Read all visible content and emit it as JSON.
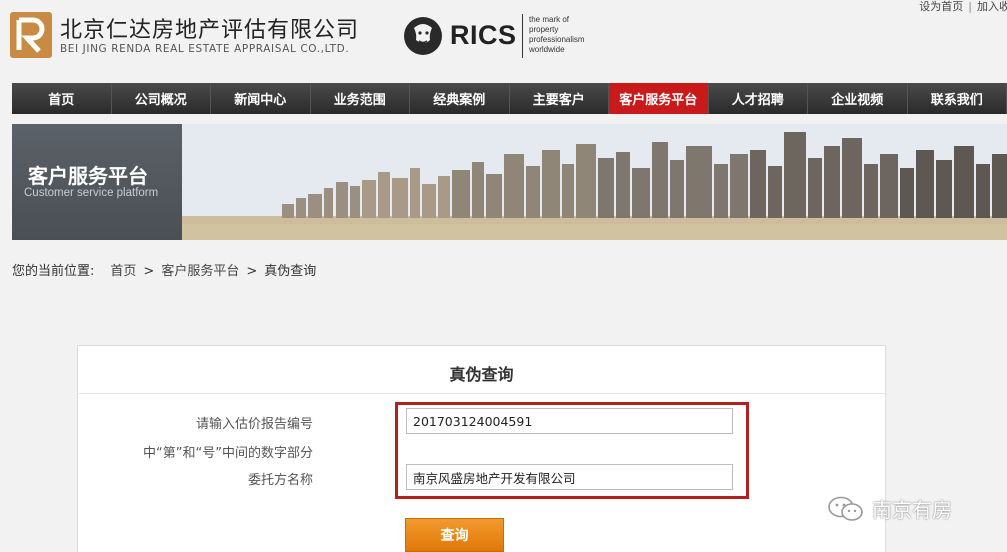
{
  "header": {
    "brand_cn": "北京仁达房地产评估有限公司",
    "brand_en": "BEI JING RENDA REAL ESTATE APPRAISAL CO.,LTD.",
    "rics_name": "RICS",
    "rics_tagline": [
      "the mark of",
      "property",
      "professionalism",
      "worldwide"
    ],
    "top_links": [
      "设为首页",
      "加入收藏"
    ]
  },
  "nav": {
    "items": [
      {
        "label": "首页"
      },
      {
        "label": "公司概况"
      },
      {
        "label": "新闻中心"
      },
      {
        "label": "业务范围"
      },
      {
        "label": "经典案例"
      },
      {
        "label": "主要客户"
      },
      {
        "label": "客户服务平台",
        "active": true
      },
      {
        "label": "人才招聘"
      },
      {
        "label": "企业视频"
      },
      {
        "label": "联系我们"
      }
    ],
    "active_color": "#c81a1a"
  },
  "banner": {
    "title": "客户服务平台",
    "subtitle": "Customer service platform"
  },
  "breadcrumb": {
    "label": "您的当前位置:",
    "items": [
      "首页",
      "客户服务平台",
      "真伪查询"
    ],
    "separator": ">"
  },
  "form": {
    "title": "真伪查询",
    "report_label": "请输入估价报告编号",
    "report_hint": "中“第”和“号”中间的数字部分",
    "report_value": "201703124004591",
    "client_label": "委托方名称",
    "client_value": "南京风盛房地产开发有限公司",
    "submit_label": "查询",
    "button_color": "#ee8a1a",
    "highlight_color": "#b32020"
  },
  "watermark": {
    "text": "南京有房"
  }
}
